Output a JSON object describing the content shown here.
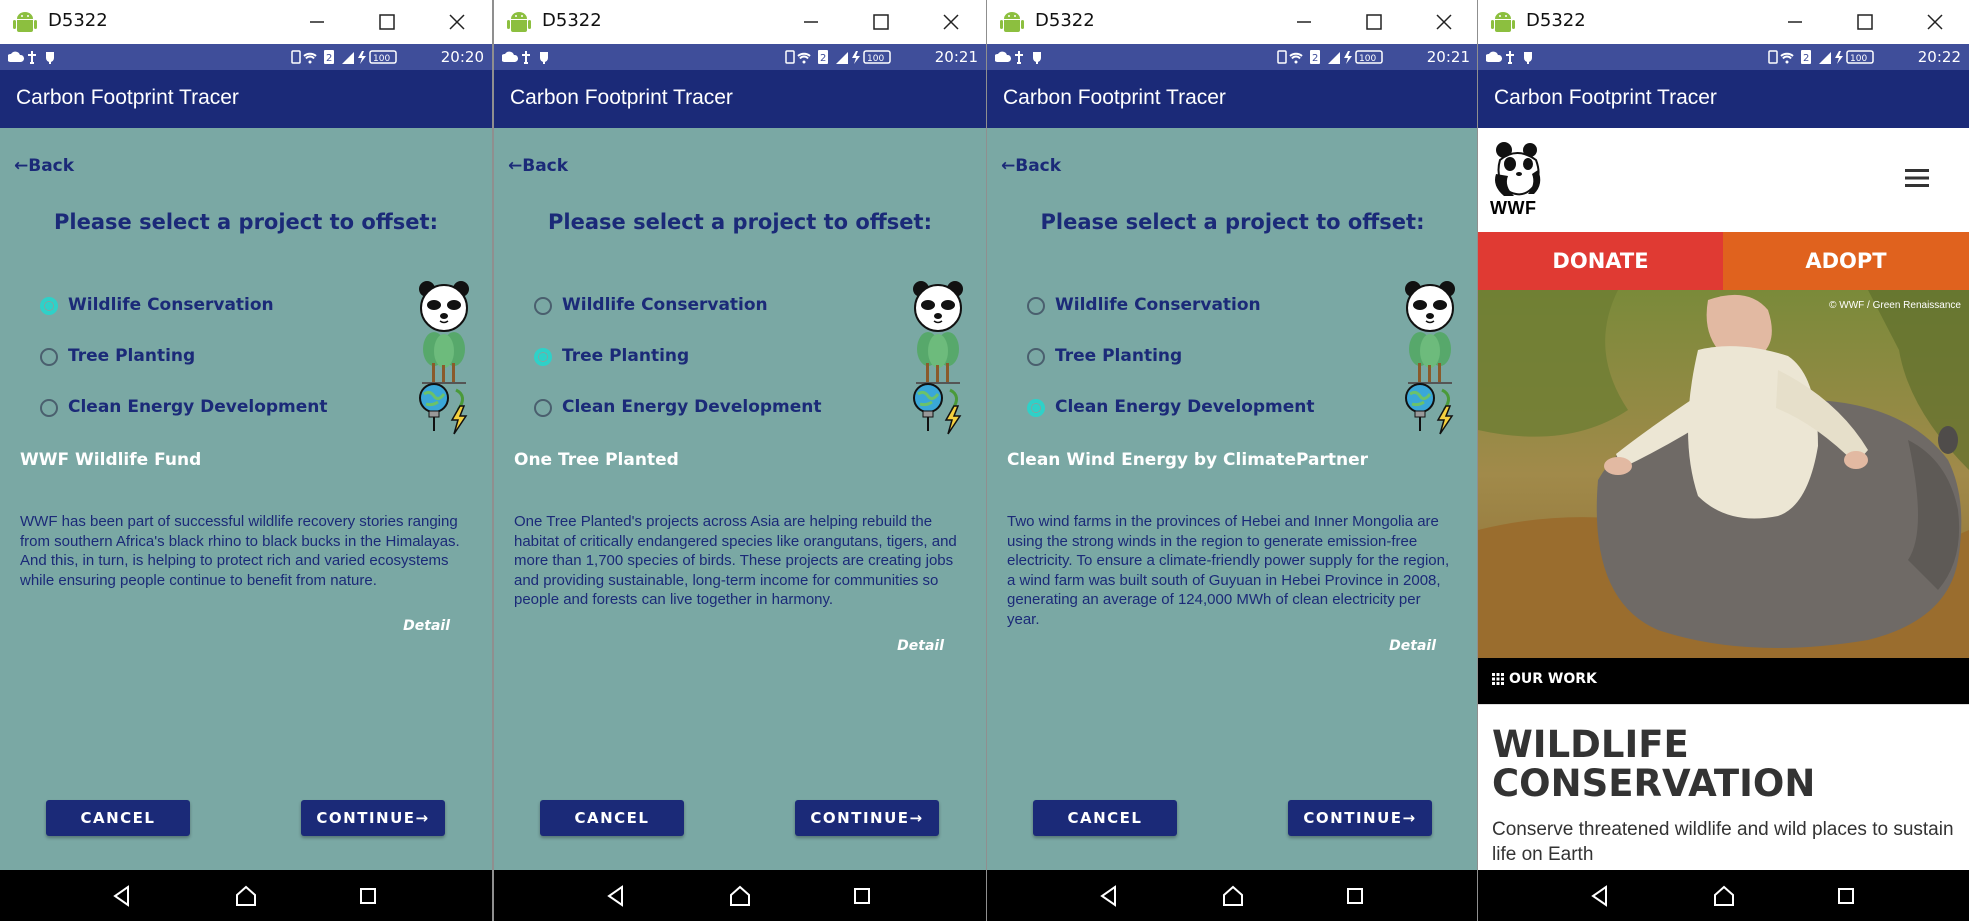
{
  "colors": {
    "app_bar": "#1b2a78",
    "status_bar": "#3f4e9a",
    "content_bg": "#7aa8a4",
    "radio_selected": "#2fd1c8",
    "donate": "#e03a33",
    "adopt": "#e0621e"
  },
  "windows": [
    {
      "title": "D5322",
      "time": "20:20",
      "battery": "100",
      "app_title": "Carbon Footprint Tracer",
      "back": "←Back",
      "heading": "Please select a project to offset:",
      "options": [
        "Wildlife Conservation",
        "Tree Planting",
        "Clean Energy Development"
      ],
      "selected_option": "Wildlife Conservation",
      "icons": [
        "panda-icon",
        "trees-icon",
        "globe-bulb-lightning-icon"
      ],
      "project_title": "WWF Wildlife Fund",
      "description": "WWF has been part of successful wildlife recovery stories ranging from southern Africa's black rhino to black bucks in the Himalayas. And this, in turn, is helping to protect rich and varied ecosystems while ensuring people continue to benefit from nature.",
      "detail": "Detail",
      "cancel": "CANCEL",
      "continue": "CONTINUE→"
    },
    {
      "title": "D5322",
      "time": "20:21",
      "battery": "100",
      "app_title": "Carbon Footprint Tracer",
      "back": "←Back",
      "heading": "Please select a project to offset:",
      "options": [
        "Wildlife Conservation",
        "Tree Planting",
        "Clean Energy Development"
      ],
      "selected_option": "Tree Planting",
      "icons": [
        "panda-icon",
        "trees-icon",
        "globe-bulb-lightning-icon"
      ],
      "project_title": "One Tree Planted",
      "description": "One Tree Planted's projects across Asia are helping rebuild the habitat of critically endangered species like orangutans, tigers, and more than 1,700 species of birds. These projects are creating jobs and providing sustainable, long-term income for communities so people and forests can live together in harmony.",
      "detail": "Detail",
      "cancel": "CANCEL",
      "continue": "CONTINUE→"
    },
    {
      "title": "D5322",
      "time": "20:21",
      "battery": "100",
      "app_title": "Carbon Footprint Tracer",
      "back": "←Back",
      "heading": "Please select a project to offset:",
      "options": [
        "Wildlife Conservation",
        "Tree Planting",
        "Clean Energy Development"
      ],
      "selected_option": "Clean Energy Development",
      "icons": [
        "panda-icon",
        "trees-icon",
        "globe-bulb-lightning-icon"
      ],
      "project_title": "Clean Wind Energy by ClimatePartner",
      "description": "Two wind farms in the provinces of Hebei and Inner Mongolia are using the strong winds in the region to generate emission-free electricity. To ensure a climate-friendly power supply for the region, a wind farm was built south of Guyuan in Hebei Province in 2008, generating an average of 124,000 MWh of clean electricity per year.",
      "detail": "Detail",
      "cancel": "CANCEL",
      "continue": "CONTINUE→"
    },
    {
      "title": "D5322",
      "time": "20:22",
      "battery": "100",
      "app_title": "Carbon Footprint Tracer",
      "wwf_logo_text": "WWF",
      "donate": "DONATE",
      "adopt": "ADOPT",
      "photo_credit": "© WWF / Green Renaissance",
      "our_work": "OUR WORK",
      "page_heading": "WILDLIFE CONSERVATION",
      "page_subheading": "Conserve threatened wildlife and wild places to sustain life on Earth"
    }
  ]
}
